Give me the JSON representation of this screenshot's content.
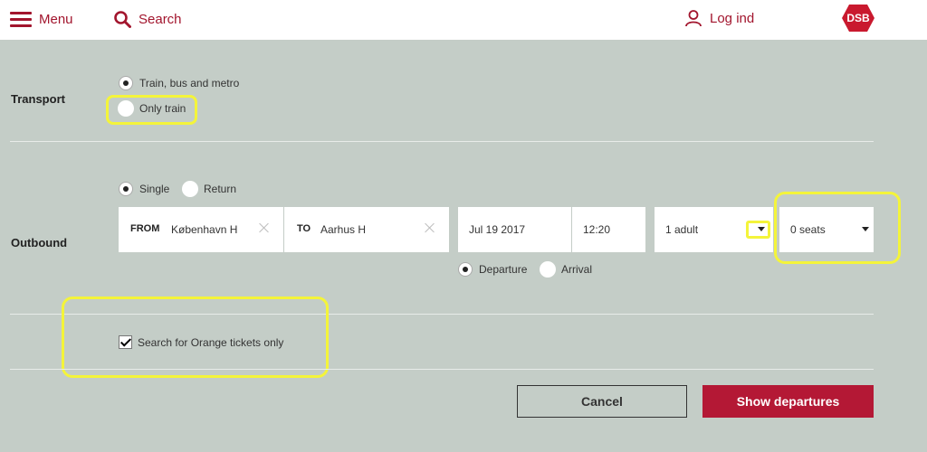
{
  "header": {
    "menu_label": "Menu",
    "search_label": "Search",
    "login_label": "Log ind",
    "logo_text": "DSB",
    "icons": {
      "menu": "hamburger-icon",
      "search": "search-icon",
      "login": "user-icon"
    },
    "colors": {
      "brand": "#a2152d",
      "logo": "#c9192e"
    }
  },
  "transport": {
    "label": "Transport",
    "options": [
      {
        "label": "Train, bus and metro",
        "selected": true
      },
      {
        "label": "Only train",
        "selected": false
      }
    ]
  },
  "outbound": {
    "label": "Outbound",
    "trip_types": [
      {
        "label": "Single",
        "selected": true
      },
      {
        "label": "Return",
        "selected": false
      }
    ],
    "from": {
      "label": "FROM",
      "value": "København H"
    },
    "to": {
      "label": "TO",
      "value": "Aarhus H"
    },
    "date": "Jul 19 2017",
    "time": "12:20",
    "passengers": "1 adult",
    "seats": "0 seats",
    "time_modes": [
      {
        "label": "Departure",
        "selected": true
      },
      {
        "label": "Arrival",
        "selected": false
      }
    ]
  },
  "orange": {
    "label": "Search for Orange tickets only",
    "checked": true
  },
  "actions": {
    "cancel_label": "Cancel",
    "show_label": "Show departures",
    "primary_color": "#b41835"
  },
  "background_color": "#c4cdc7"
}
